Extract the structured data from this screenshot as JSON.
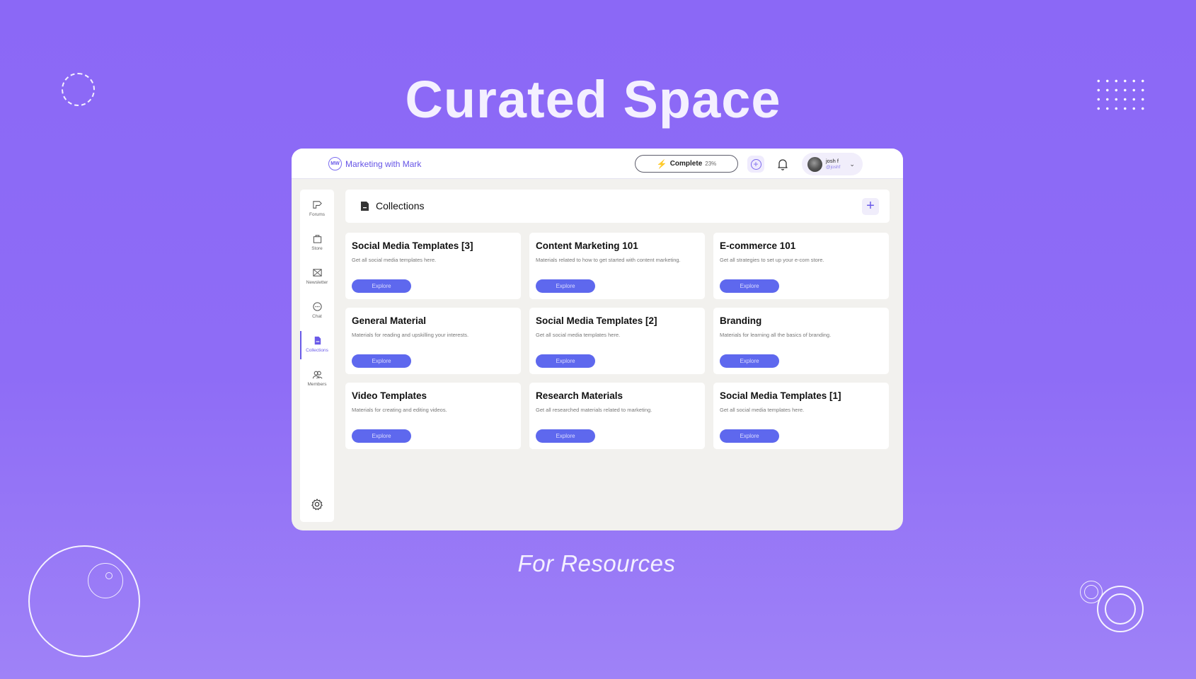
{
  "headline": "Curated Space",
  "subline": "For Resources",
  "app": {
    "brand": {
      "logo_text": "MW",
      "name": "Marketing with Mark"
    },
    "topbar": {
      "complete_label": "Complete",
      "complete_percent": "23%",
      "user": {
        "name": "josh f",
        "handle": "@joshf"
      }
    },
    "sidebar": {
      "items": [
        {
          "label": "Forums",
          "icon": "megaphone-icon"
        },
        {
          "label": "Store",
          "icon": "shopping-bag-icon"
        },
        {
          "label": "Newsletter",
          "icon": "mail-icon"
        },
        {
          "label": "Chat",
          "icon": "chat-bubble-icon"
        },
        {
          "label": "Collections",
          "icon": "document-icon",
          "active": true
        },
        {
          "label": "Members",
          "icon": "users-icon"
        }
      ],
      "settings_icon": "gear-icon"
    },
    "collections": {
      "title": "Collections",
      "add_label": "+",
      "cards": [
        {
          "title": "Social Media Templates [3]",
          "description": "Get all social media templates here.",
          "button": "Explore"
        },
        {
          "title": "Content Marketing 101",
          "description": "Materials related to how to get started with content marketing.",
          "button": "Explore"
        },
        {
          "title": "E-commerce 101",
          "description": "Get all strategies to set up your e-com store.",
          "button": "Explore"
        },
        {
          "title": "General Material",
          "description": "Materials for reading and upskilling your interests.",
          "button": "Explore"
        },
        {
          "title": "Social Media Templates [2]",
          "description": "Get all social media templates here.",
          "button": "Explore"
        },
        {
          "title": "Branding",
          "description": "Materials for learning all the basics of branding.",
          "button": "Explore"
        },
        {
          "title": "Video Templates",
          "description": "Materials for creating and editing videos.",
          "button": "Explore"
        },
        {
          "title": "Research Materials",
          "description": "Get all researched materials related to marketing.",
          "button": "Explore"
        },
        {
          "title": "Social Media Templates [1]",
          "description": "Get all social media templates here.",
          "button": "Explore"
        }
      ]
    }
  },
  "colors": {
    "background": "#8b68f6",
    "accent": "#6a5ae8",
    "button": "#5e68ee",
    "panel": "#f2f1ee"
  }
}
